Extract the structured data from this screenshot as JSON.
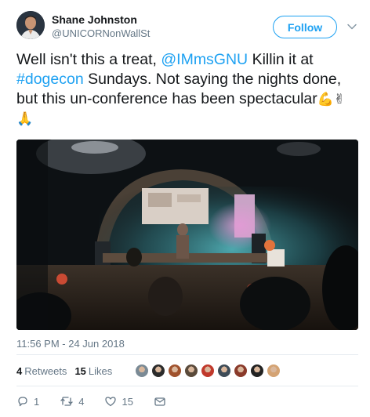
{
  "author": {
    "name": "Shane Johnston",
    "handle": "@UNICORNonWallSt"
  },
  "follow_label": "Follow",
  "tweet": {
    "part1": "Well isn't this a treat, ",
    "mention": "@IMmsGNU",
    "part2": " Killin it at ",
    "hashtag": "#dogecon",
    "part3": " Sundays. Not saying the nights done, but this un-conference has been spectacular",
    "emojis": [
      "💪",
      "✌",
      "🙏"
    ]
  },
  "timestamp": "11:56 PM - 24 Jun 2018",
  "stats": {
    "retweets_count": "4",
    "retweets_label": "Retweets",
    "likes_count": "15",
    "likes_label": "Likes"
  },
  "likers": [
    "#7a8a95",
    "#2b2b2b",
    "#a0522d",
    "#5a4a3a",
    "#c0392b",
    "#3d4b57",
    "#8a3a2a",
    "#222222",
    "#d4a373"
  ],
  "actions": {
    "reply_count": "1",
    "retweet_count": "4",
    "like_count": "15"
  },
  "colors": {
    "accent": "#1da1f2",
    "secondary_text": "#657786",
    "divider": "#e6ecf0"
  }
}
